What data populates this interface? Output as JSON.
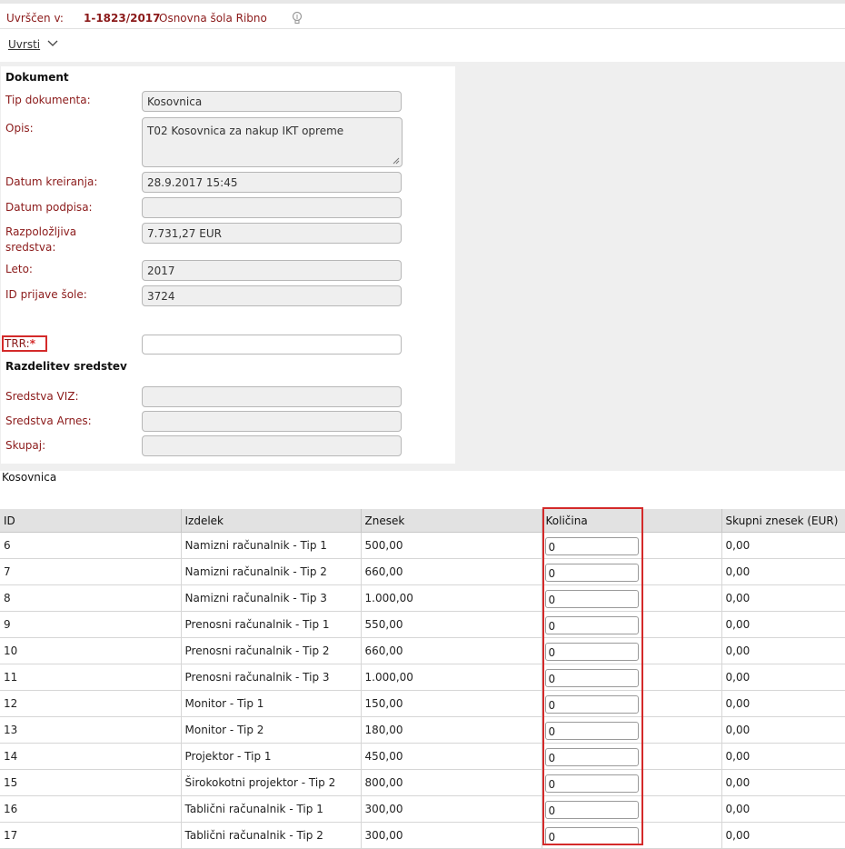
{
  "header": {
    "label": "Uvrščen v:",
    "number": "1-1823/2017",
    "name": "Osnovna šola Ribno",
    "bulb_icon": "lightbulb-icon"
  },
  "actions": {
    "uvrsti_label": "Uvrsti"
  },
  "document": {
    "section_title": "Dokument",
    "fields": {
      "tip_label": "Tip dokumenta:",
      "tip_value": "Kosovnica",
      "opis_label": "Opis:",
      "opis_value": "T02 Kosovnica za nakup IKT opreme",
      "datum_kreiranja_label": "Datum kreiranja:",
      "datum_kreiranja_value": "28.9.2017 15:45",
      "datum_podpisa_label": "Datum podpisa:",
      "datum_podpisa_value": "",
      "razpolozljiva_label_1": "Razpoložljiva",
      "razpolozljiva_label_2": "sredstva:",
      "razpolozljiva_value": "7.731,27 EUR",
      "leto_label": "Leto:",
      "leto_value": "2017",
      "id_prijave_label": "ID prijave šole:",
      "id_prijave_value": "3724",
      "trr_label": "TRR:",
      "trr_required": "*",
      "trr_value": ""
    },
    "razdelitev_title": "Razdelitev sredstev",
    "razdelitev": {
      "viz_label": "Sredstva VIZ:",
      "viz_value": "",
      "arnes_label": "Sredstva Arnes:",
      "arnes_value": "",
      "skupaj_label": "Skupaj:",
      "skupaj_value": ""
    }
  },
  "kosovnica": {
    "title": "Kosovnica",
    "columns": [
      "ID",
      "Izdelek",
      "Znesek",
      "Količina",
      "Skupni znesek (EUR)"
    ],
    "rows": [
      {
        "id": "6",
        "izdelek": "Namizni računalnik - Tip 1",
        "znesek": "500,00",
        "kolicina": "0",
        "skupni": "0,00"
      },
      {
        "id": "7",
        "izdelek": "Namizni računalnik - Tip 2",
        "znesek": "660,00",
        "kolicina": "0",
        "skupni": "0,00"
      },
      {
        "id": "8",
        "izdelek": "Namizni računalnik - Tip 3",
        "znesek": "1.000,00",
        "kolicina": "0",
        "skupni": "0,00"
      },
      {
        "id": "9",
        "izdelek": "Prenosni računalnik - Tip 1",
        "znesek": "550,00",
        "kolicina": "0",
        "skupni": "0,00"
      },
      {
        "id": "10",
        "izdelek": "Prenosni računalnik - Tip 2",
        "znesek": "660,00",
        "kolicina": "0",
        "skupni": "0,00"
      },
      {
        "id": "11",
        "izdelek": "Prenosni računalnik - Tip 3",
        "znesek": "1.000,00",
        "kolicina": "0",
        "skupni": "0,00"
      },
      {
        "id": "12",
        "izdelek": "Monitor - Tip 1",
        "znesek": "150,00",
        "kolicina": "0",
        "skupni": "0,00"
      },
      {
        "id": "13",
        "izdelek": "Monitor - Tip 2",
        "znesek": "180,00",
        "kolicina": "0",
        "skupni": "0,00"
      },
      {
        "id": "14",
        "izdelek": "Projektor - Tip 1",
        "znesek": "450,00",
        "kolicina": "0",
        "skupni": "0,00"
      },
      {
        "id": "15",
        "izdelek": "Širokokotni projektor - Tip 2",
        "znesek": "800,00",
        "kolicina": "0",
        "skupni": "0,00"
      },
      {
        "id": "16",
        "izdelek": "Tablični računalnik - Tip 1",
        "znesek": "300,00",
        "kolicina": "0",
        "skupni": "0,00"
      },
      {
        "id": "17",
        "izdelek": "Tablični računalnik - Tip 2",
        "znesek": "300,00",
        "kolicina": "0",
        "skupni": "0,00"
      }
    ]
  },
  "colors": {
    "label_red": "#8b1a1a",
    "highlight_red": "#d42a2a",
    "field_bg": "#efefef"
  }
}
